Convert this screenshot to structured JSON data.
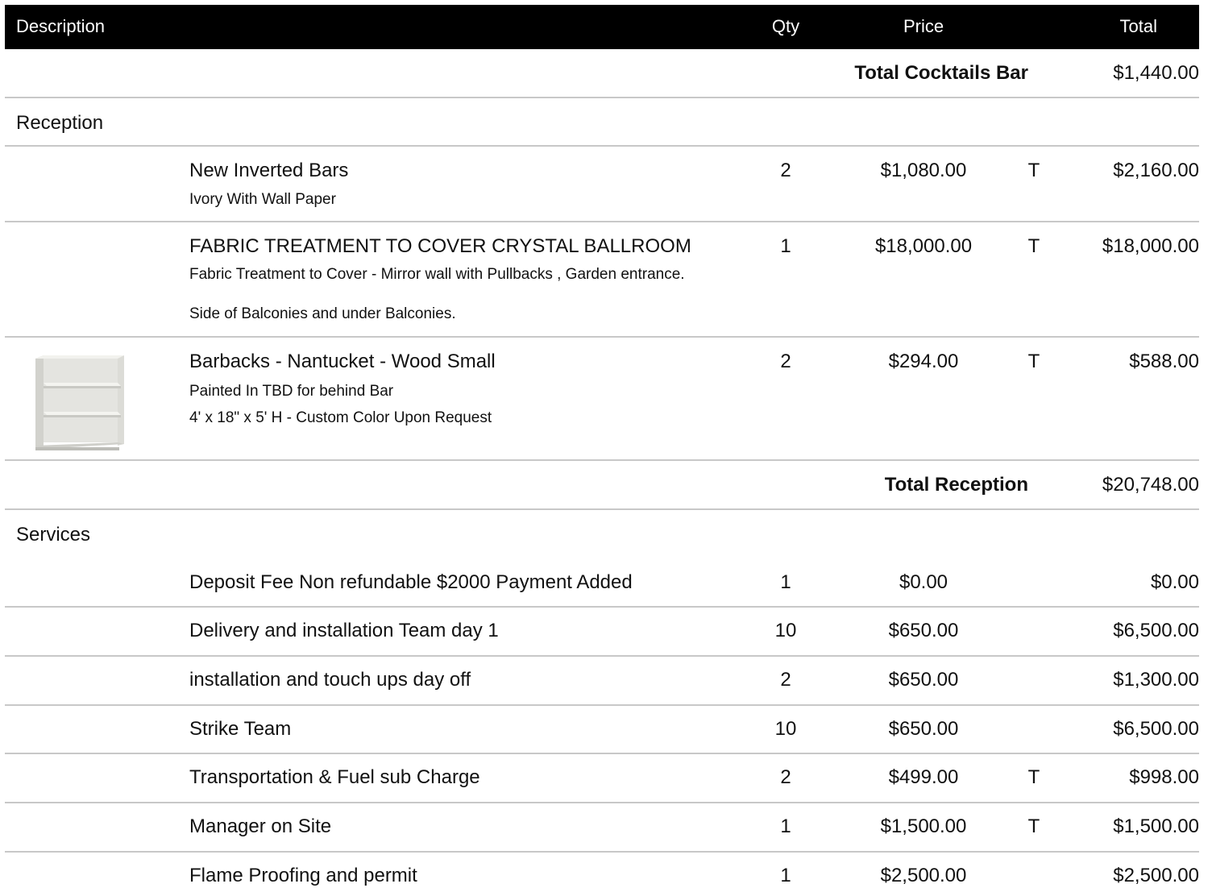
{
  "header": {
    "description": "Description",
    "qty": "Qty",
    "price": "Price",
    "total": "Total"
  },
  "subtotal_cocktails": {
    "label": "Total Cocktails Bar",
    "amount": "$1,440.00"
  },
  "reception": {
    "title": "Reception",
    "items": [
      {
        "name": "New Inverted Bars",
        "sub1": "Ivory With Wall Paper",
        "qty": "2",
        "price": "$1,080.00",
        "tax": "T",
        "total": "$2,160.00"
      },
      {
        "name": "FABRIC TREATMENT  TO COVER CRYSTAL BALLROOM",
        "sub1": "Fabric Treatment to Cover - Mirror wall with Pullbacks , Garden entrance.",
        "sub2": "Side of Balconies and under Balconies.",
        "qty": "1",
        "price": "$18,000.00",
        "tax": "T",
        "total": "$18,000.00"
      },
      {
        "name": "Barbacks - Nantucket - Wood Small",
        "sub1": "Painted In TBD for behind Bar",
        "sub2": "4' x 18\" x 5' H - Custom Color Upon Request",
        "qty": "2",
        "price": "$294.00",
        "tax": "T",
        "total": "$588.00",
        "image_icon": "white-shelf-barback-image"
      }
    ],
    "subtotal_label": "Total Reception",
    "subtotal_amount": "$20,748.00"
  },
  "services": {
    "title": "Services",
    "items": [
      {
        "name": "Deposit Fee Non refundable $2000 Payment Added",
        "qty": "1",
        "price": "$0.00",
        "tax": "",
        "total": "$0.00"
      },
      {
        "name": "Delivery and installation Team day 1",
        "qty": "10",
        "price": "$650.00",
        "tax": "",
        "total": "$6,500.00"
      },
      {
        "name": "installation and touch ups day off",
        "qty": "2",
        "price": "$650.00",
        "tax": "",
        "total": "$1,300.00"
      },
      {
        "name": "Strike Team",
        "qty": "10",
        "price": "$650.00",
        "tax": "",
        "total": "$6,500.00"
      },
      {
        "name": "Transportation & Fuel sub Charge",
        "qty": "2",
        "price": "$499.00",
        "tax": "T",
        "total": "$998.00"
      },
      {
        "name": "Manager on Site",
        "qty": "1",
        "price": "$1,500.00",
        "tax": "T",
        "total": "$1,500.00"
      },
      {
        "name": "Flame Proofing and permit",
        "qty": "1",
        "price": "$2,500.00",
        "tax": "",
        "total": "$2,500.00"
      }
    ]
  }
}
